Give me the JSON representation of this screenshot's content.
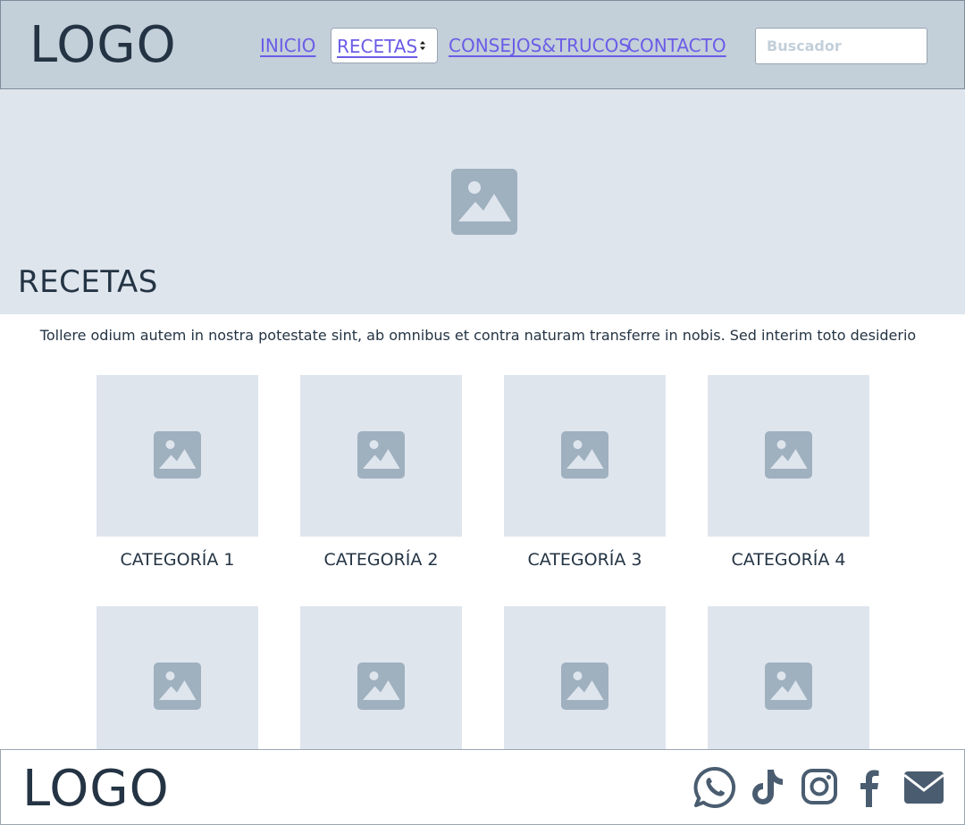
{
  "header": {
    "logo": "LOGO",
    "nav": {
      "inicio": "INICIO",
      "recetas": "RECETAS",
      "consejos": "CONSEJOS&TRUCOS",
      "contacto": "CONTACTO"
    },
    "search": {
      "placeholder": "Buscador",
      "value": ""
    }
  },
  "hero": {
    "title": "RECETAS",
    "image_icon": "image-placeholder-icon"
  },
  "intro": "Tollere odium autem in nostra potestate sint, ab omnibus et contra naturam transferre in nobis. Sed interim toto desiderio",
  "categories": [
    {
      "label": "CATEGORÍA 1"
    },
    {
      "label": "CATEGORÍA 2"
    },
    {
      "label": "CATEGORÍA 3"
    },
    {
      "label": "CATEGORÍA 4"
    },
    {
      "label": ""
    },
    {
      "label": ""
    },
    {
      "label": ""
    },
    {
      "label": ""
    }
  ],
  "footer": {
    "logo": "LOGO",
    "social_icons": [
      "whatsapp-icon",
      "tiktok-icon",
      "instagram-icon",
      "facebook-icon",
      "email-icon"
    ]
  },
  "colors": {
    "header_bg": "#c3cfd9",
    "hero_bg": "#dfe5ed",
    "link": "#6b5ce7",
    "text": "#243444",
    "icon": "#9fb0bf"
  }
}
